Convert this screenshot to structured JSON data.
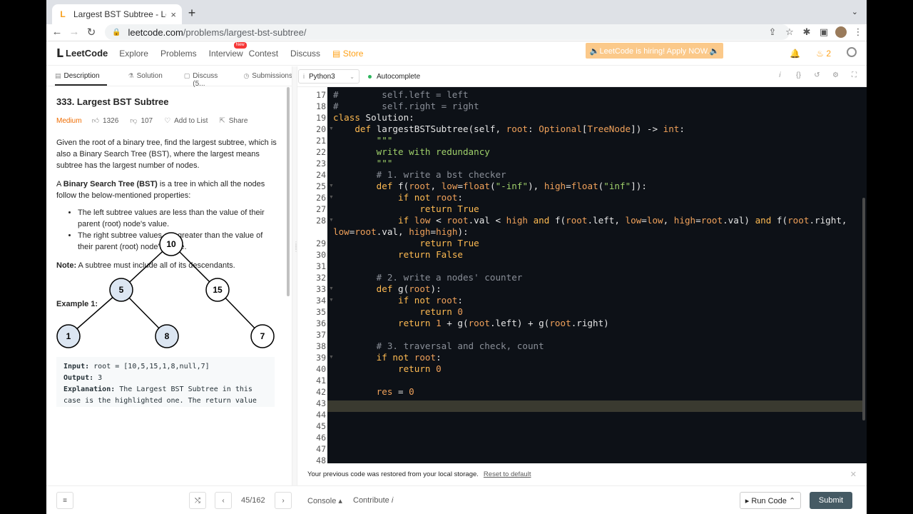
{
  "browser": {
    "tab_title": "Largest BST Subtree - LeetCo",
    "tab_close": "×",
    "new_tab": "+",
    "url_domain": "leetcode.com",
    "url_path": "/problems/largest-bst-subtree/"
  },
  "lcnav": {
    "logo": "LeetCode",
    "links": [
      "Explore",
      "Problems",
      "Interview",
      "Contest",
      "Discuss"
    ],
    "new_badge": "New",
    "store": "Store",
    "hiring_banner": "🔈LeetCode is hiring! Apply NOW.🔈",
    "fire_count": "2"
  },
  "left_tabs": {
    "description": "Description",
    "solution": "Solution",
    "discuss": "Discuss (5...",
    "submissions": "Submissions"
  },
  "problem": {
    "title": "333. Largest BST Subtree",
    "difficulty": "Medium",
    "likes": "1326",
    "dislikes": "107",
    "add_to_list": "Add to List",
    "share": "Share",
    "para1": "Given the root of a binary tree, find the largest subtree, which is also a Binary Search Tree (BST), where the largest means subtree has the largest number of nodes.",
    "para2_prefix": "A ",
    "para2_bold": "Binary Search Tree (BST)",
    "para2_rest": " is a tree in which all the nodes follow the below-mentioned properties:",
    "bullet1": "The left subtree values are less than the value of their parent (root) node's value.",
    "bullet2": "The right subtree values are greater than the value of their parent (root) node's value.",
    "note_label": "Note:",
    "note_text": " A subtree must include all of its descendants.",
    "example_title": "Example 1:",
    "tree_nodes": [
      "10",
      "5",
      "15",
      "1",
      "8",
      "7"
    ],
    "input_label": "Input:",
    "input_value": " root = [10,5,15,1,8,null,7]",
    "output_label": "Output:",
    "output_value": " 3",
    "explanation_label": "Explanation:",
    "explanation_value": " The Largest BST Subtree in this case is the highlighted one. The return value is"
  },
  "editor": {
    "language": "Python3",
    "autocomplete": "Autocomplete",
    "line_numbers": [
      "17",
      "18",
      "19",
      "20",
      "21",
      "22",
      "23",
      "24",
      "25",
      "26",
      "27",
      "28",
      "",
      "29",
      "30",
      "31",
      "32",
      "33",
      "34",
      "35",
      "36",
      "37",
      "38",
      "39",
      "40",
      "41",
      "42",
      "43",
      "44",
      "45",
      "46",
      "47",
      "48"
    ]
  },
  "notice": {
    "text": "Your previous code was restored from your local storage.",
    "link": "Reset to default"
  },
  "bottom": {
    "problems_list": "≡",
    "shuffle": "⤭",
    "prev": "‹",
    "page": "45/162",
    "next": "›",
    "console": "Console ▴",
    "contribute": "Contribute 𝑖",
    "run": "▸ Run Code ⌃",
    "submit": "Submit"
  }
}
